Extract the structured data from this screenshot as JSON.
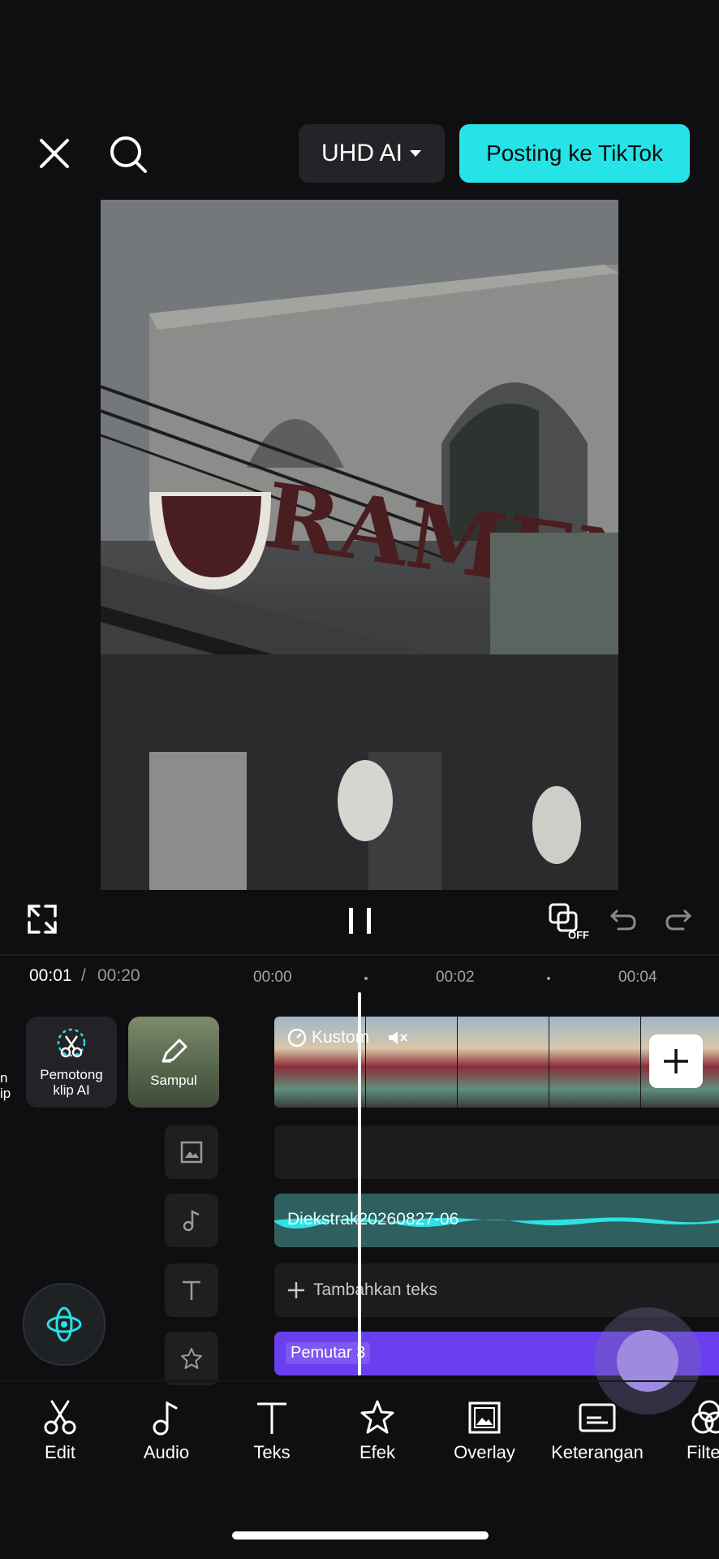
{
  "top_bar": {
    "quality_label": "UHD AI",
    "post_label": "Posting ke TikTok"
  },
  "preview": {
    "sign_text": "RAMEN"
  },
  "playback": {
    "current_time": "00:01",
    "separator": "/",
    "total_time": "00:20",
    "ruler_marks": [
      "00:00",
      "00:02",
      "00:04"
    ],
    "loop_badge": "OFF"
  },
  "timeline": {
    "left_partial_text": [
      "n",
      "ip"
    ],
    "ai_clipper_label": "Pemotong klip AI",
    "cover_label": "Sampul",
    "video_track_label": "Kustom",
    "audio_track_label": "Diekstrak20260827-06",
    "add_text_label": "Tambahkan teks",
    "effect_track_label": "Pemutar 3"
  },
  "toolbar": {
    "items": [
      {
        "label": "Edit",
        "icon": "scissors-icon"
      },
      {
        "label": "Audio",
        "icon": "music-note-icon"
      },
      {
        "label": "Teks",
        "icon": "text-icon"
      },
      {
        "label": "Efek",
        "icon": "star-effect-icon"
      },
      {
        "label": "Overlay",
        "icon": "overlay-icon"
      },
      {
        "label": "Keterangan",
        "icon": "captions-icon"
      },
      {
        "label": "Filte",
        "icon": "filter-icon"
      }
    ]
  },
  "colors": {
    "accent": "#25e3e6",
    "audio_track": "#2f5f5e",
    "effect_track": "#6a3ff0"
  }
}
